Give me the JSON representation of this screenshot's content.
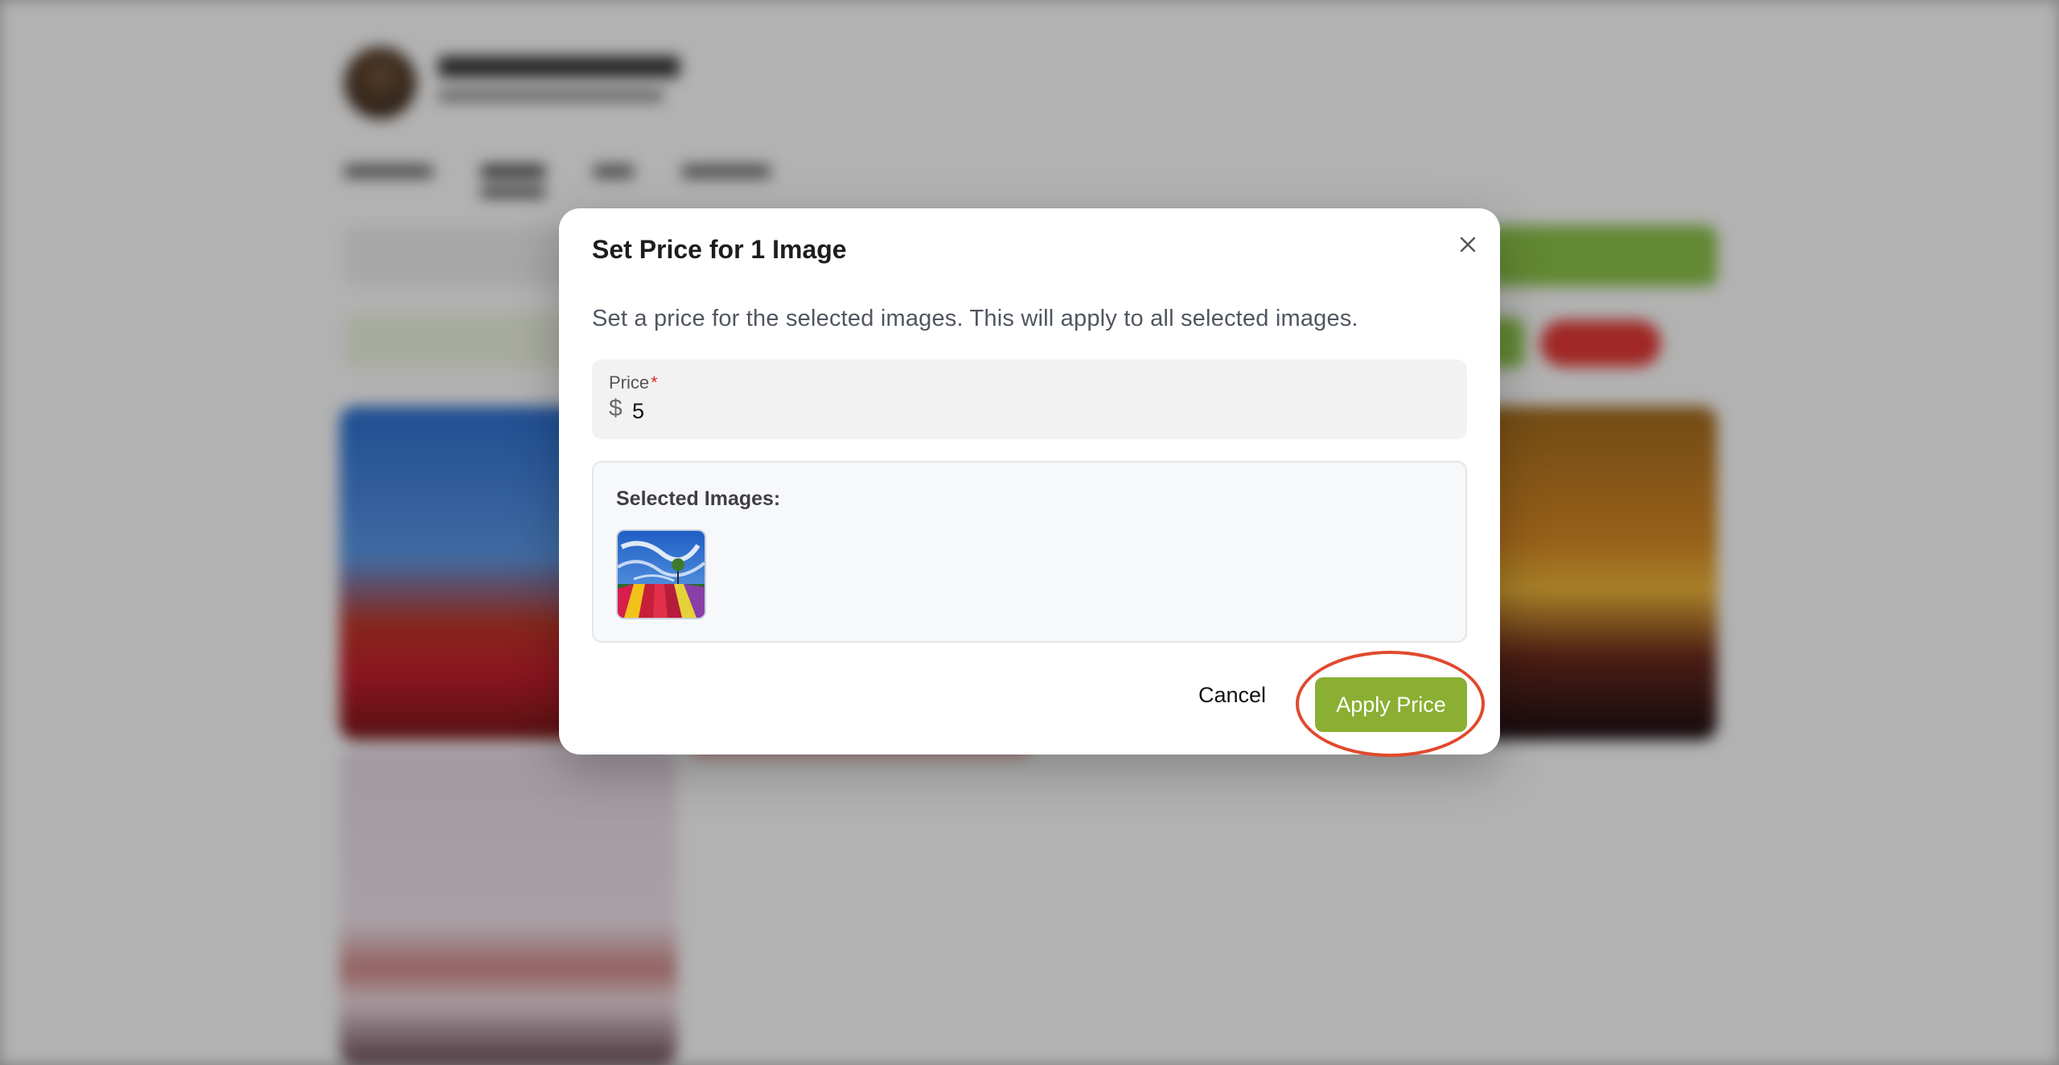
{
  "modal": {
    "title": "Set Price for 1 Image",
    "description": "Set a price for the selected images. This will apply to all selected images.",
    "price_field": {
      "label": "Price",
      "required_marker": "*",
      "currency_symbol": "$",
      "value": "5"
    },
    "selected_images": {
      "title": "Selected Images:",
      "thumbnails": [
        {
          "icon": "tulip-field-thumbnail"
        }
      ]
    },
    "cancel_label": "Cancel",
    "apply_label": "Apply Price",
    "close_icon": "close-icon"
  },
  "colors": {
    "accent": "#8aaf33",
    "highlight": "#e04a2d",
    "required": "#d32f2f"
  }
}
